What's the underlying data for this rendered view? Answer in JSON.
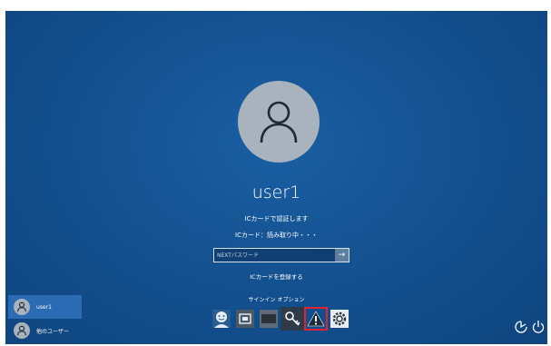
{
  "user": {
    "name": "user1"
  },
  "messages": {
    "ic_auth": "ICカードで認証します",
    "ic_status": "ICカード：読み取り中・・・"
  },
  "password": {
    "placeholder": "NEXTパスワード"
  },
  "register_link": "ICカードを登録する",
  "signin_options_label": "サインイン オプション",
  "signin_options": [
    {
      "name": "face-option",
      "icon": "face-icon"
    },
    {
      "name": "smartcard-option",
      "icon": "smartcard-icon"
    },
    {
      "name": "card-option",
      "icon": "card-icon"
    },
    {
      "name": "key-option",
      "icon": "key-icon"
    },
    {
      "name": "warning-option",
      "icon": "warning-icon",
      "selected": true
    },
    {
      "name": "gear-option",
      "icon": "gear-icon"
    }
  ],
  "user_list": [
    {
      "label": "user1",
      "active": true
    },
    {
      "label": "他のユーザー",
      "active": false
    }
  ],
  "colors": {
    "background": "#134f8e",
    "selected_border": "#e0232e",
    "active_user": "#2a6bb3"
  }
}
